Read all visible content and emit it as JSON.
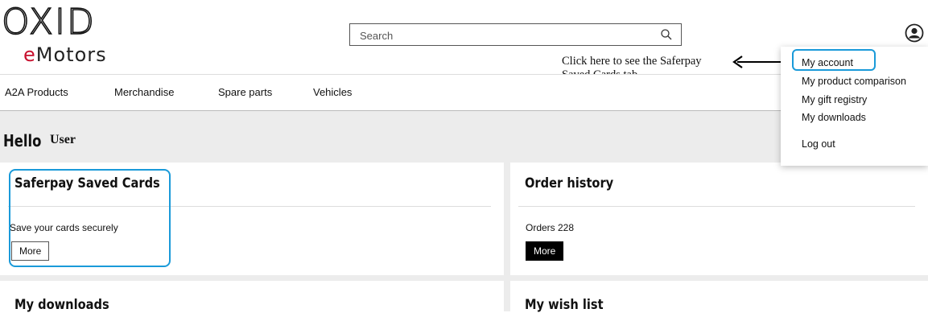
{
  "header": {
    "logo_line1": "OXID",
    "logo_line2_e": "e",
    "logo_line2_rest": "Motors",
    "search_placeholder": "Search"
  },
  "annotation": {
    "line1": "Click here to see the Saferpay",
    "line2": "Saved Cards tab"
  },
  "nav": {
    "items": [
      {
        "label": "A2A Products"
      },
      {
        "label": "Merchandise"
      },
      {
        "label": "Spare parts"
      },
      {
        "label": "Vehicles"
      }
    ]
  },
  "greeting": {
    "hello": "Hello",
    "user": "User"
  },
  "cards": [
    {
      "title": "Saferpay Saved Cards",
      "text": "Save your cards securely",
      "button": "More"
    },
    {
      "title": "Order history",
      "text": "Orders 228",
      "button": "More"
    },
    {
      "title": "My downloads"
    },
    {
      "title": "My wish list"
    }
  ],
  "account_menu": {
    "items": [
      {
        "label": "My account"
      },
      {
        "label": "My product comparison"
      },
      {
        "label": "My gift registry"
      },
      {
        "label": "My downloads"
      },
      {
        "label": "Log out"
      }
    ]
  },
  "colors": {
    "highlight": "#1a9ad9",
    "logo_accent": "#c8102e",
    "band_gray": "#ececec"
  }
}
